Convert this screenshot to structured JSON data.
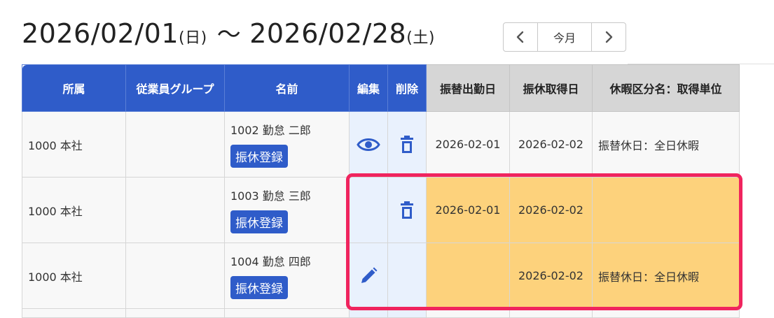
{
  "period": {
    "start_date": "2026/02/01",
    "start_dow": "(日)",
    "separator": "〜",
    "end_date": "2026/02/28",
    "end_dow": "(土)"
  },
  "month_nav": {
    "prev_icon": "chevron-left-icon",
    "current_label": "今月",
    "next_icon": "chevron-right-icon"
  },
  "table": {
    "headers": {
      "dept": "所属",
      "group": "従業員グループ",
      "name": "名前",
      "edit": "編集",
      "delete": "削除",
      "work_date": "振替出勤日",
      "leave_date": "振休取得日",
      "leave_type": "休暇区分名：取得単位"
    },
    "rows": [
      {
        "dept": "1000 本社",
        "group": "",
        "name": "1002 勤怠 二郎",
        "register_label": "振休登録",
        "edit_icon": "eye-icon",
        "delete_icon": "trash-icon",
        "work_date": "2026-02-01",
        "leave_date": "2026-02-02",
        "leave_type": "振替休日：全日休暇"
      },
      {
        "dept": "1000 本社",
        "group": "",
        "name": "1003 勤怠 三郎",
        "register_label": "振休登録",
        "edit_icon": "",
        "delete_icon": "trash-icon",
        "work_date": "2026-02-01",
        "leave_date": "2026-02-02",
        "leave_type": ""
      },
      {
        "dept": "1000 本社",
        "group": "",
        "name": "1004 勤怠 四郎",
        "register_label": "振休登録",
        "edit_icon": "pencil-icon",
        "delete_icon": "",
        "work_date": "",
        "leave_date": "2026-02-02",
        "leave_type": "振替休日：全日休暇"
      }
    ]
  },
  "colors": {
    "header_blue": "#2f5cc9",
    "header_gray": "#d6d6d6",
    "highlight_orange": "#fdd27c",
    "action_cell_bg": "#e9f1fd",
    "highlight_border": "#f0245e"
  }
}
